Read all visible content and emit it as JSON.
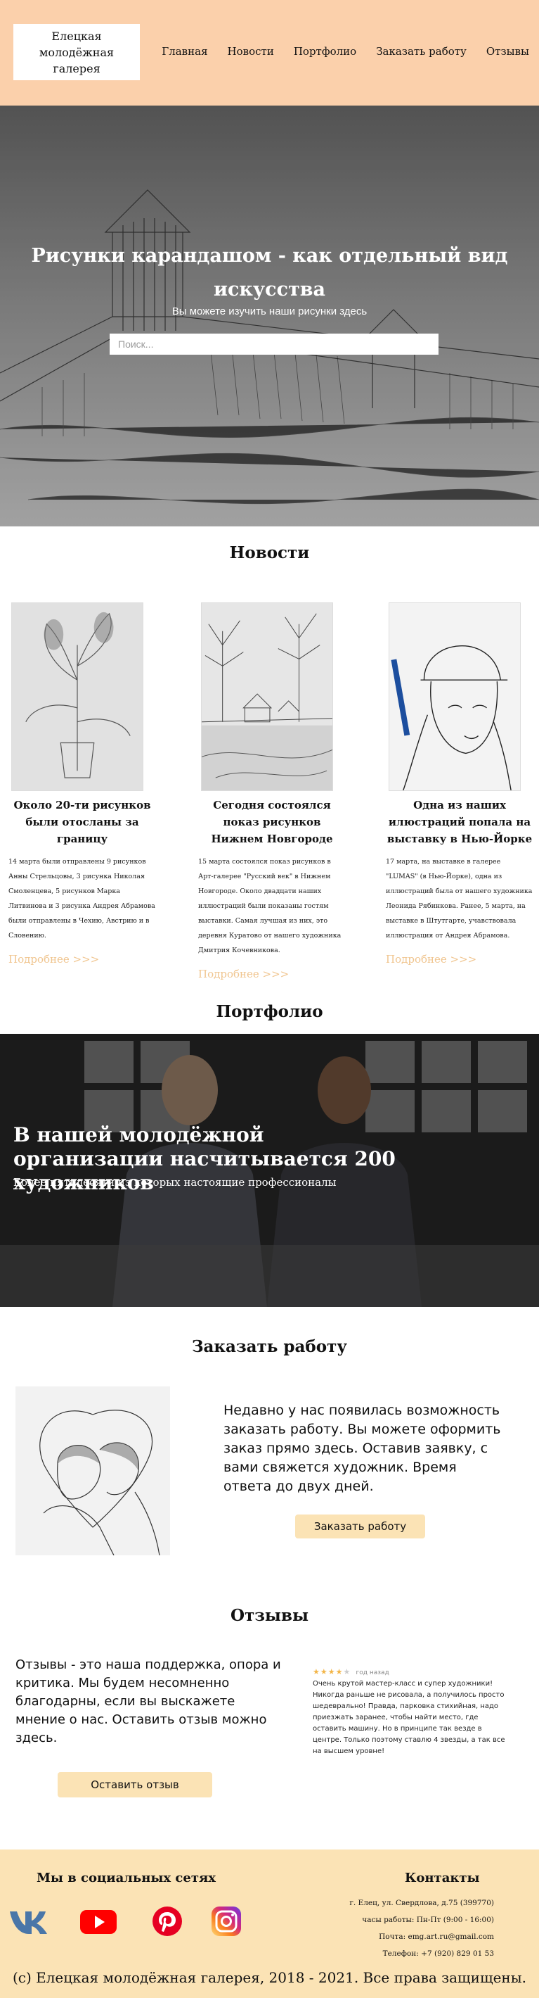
{
  "header": {
    "logo": "Елецкая молодёжная галерея",
    "nav": [
      "Главная",
      "Новости",
      "Портфолио",
      "Заказать работу",
      "Отзывы"
    ]
  },
  "hero": {
    "title": "Рисунки карандашом - как отдельный вид искусства",
    "subtitle": "Вы можете изучить наши рисунки здесь",
    "search_placeholder": "Поиск..."
  },
  "news": {
    "title": "Новости",
    "items": [
      {
        "heading": "Около 20-ти рисунков были отосланы за границу",
        "text": "14 марта были отправлены 9 рисунков Анны Стрельцовы, 3 рисунка Николая Смоленцева, 5 рисунков Марка Литвинова и 3 рисунка Андрея Абрамова были отправлены в Чехию, Австрию и в Словению.",
        "more": "Подробнее >>>"
      },
      {
        "heading": "Сегодня состоялся показ рисунков Нижнем Новгороде",
        "text": "15 марта состоялся показ рисунков в Арт-галерее \"Русский век\" в Нижнем Новгороде. Около двадцати наших иллюстраций были показаны гостям выставки. Самая лучшая из них, это деревня Куратово от нашего художника Дмитрия Кочевникова.",
        "more": "Подробнее >>>"
      },
      {
        "heading": "Одна из наших илюстраций попала на выставку в Нью-Йорке",
        "text": "17 марта, на выставке в галерее \"LUMAS\" (в Нью-Йорке), одна из иллюстраций была от нашего художника Леонида Рябинкова. Ранее, 5 марта, на выставке в Штутгарте, учавствовала иллюстрация от Андрея Абрамова.",
        "more": "Подробнее >>>"
      }
    ]
  },
  "portfolio": {
    "title": "Портфолио",
    "banner_title": "В нашей молодёжной организации насчитывается 200 художников",
    "banner_subtitle": "Более пятидесяти из которых настоящие профессионалы"
  },
  "order": {
    "title": "Заказать работу",
    "text": "Недавно у нас появилась возможность заказать работу. Вы можете оформить заказ прямо здесь. Оставив заявку, с вами свяжется художник. Время ответа до двух дней.",
    "button": "Заказать работу"
  },
  "reviews": {
    "title": "Отзывы",
    "text": "Отзывы - это наша поддержка, опора и критика. Мы будем несомненно благодарны, если вы выскажете мнение о нас. Оставить отзыв можно здесь.",
    "button": "Оставить отзыв",
    "review": {
      "rating": 4,
      "date": "год назад",
      "text": "Очень крутой мастер-класс и супер художники! Никогда раньше не рисовала, а получилось просто шедеврально! Правда, парковка стихийная, надо приезжать заранее, чтобы найти место, где оставить машину. Но в принципе так везде в центре. Только поэтому ставлю 4 звезды, а так все на высшем уровне!"
    }
  },
  "footer": {
    "social_title": "Мы в социальных сетях",
    "contacts_title": "Контакты",
    "social_icons": [
      "vk-icon",
      "youtube-icon",
      "pinterest-icon",
      "instagram-icon"
    ],
    "contacts": [
      "г. Елец, ул. Свердлова, д.75 (399770)",
      "часы работы: Пн-Пт (9:00 - 16:00)",
      "Почта: emg.art.ru@gmail.com",
      "Телефон: +7 (920) 829 01 53"
    ],
    "copyright": "(с) Елецкая молодёжная галерея, 2018 - 2021. Все права защищены."
  },
  "colors": {
    "header_bg": "#fbd0ab",
    "footer_bg": "#fbe3b5",
    "button_bg": "#fbe3b5",
    "link_accent": "#f0c58f",
    "star": "#f3b64a"
  }
}
